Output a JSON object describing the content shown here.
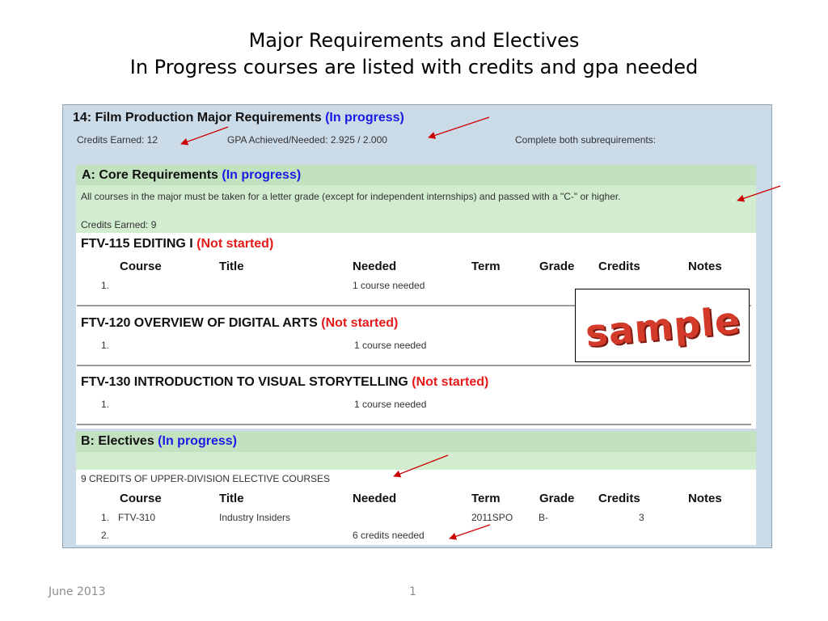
{
  "slide": {
    "title_line1": "Major Requirements and Electives",
    "title_line2": "In Progress courses are listed with credits and gpa needed",
    "footer_date": "June 2013",
    "page_number": "1"
  },
  "major": {
    "title": "14: Film Production Major Requirements",
    "status": "(In progress)",
    "credits_earned": "Credits Earned: 12",
    "gpa": "GPA Achieved/Needed: 2.925 / 2.000",
    "instruction": "Complete both subrequirements:"
  },
  "core": {
    "title": "A: Core Requirements",
    "status": "(In progress)",
    "note": "All courses in the major must be taken for a letter grade (except for independent internships) and passed with a \"C-\" or higher.",
    "credits_earned": "Credits Earned: 9",
    "courses": [
      {
        "name": "FTV-115 EDITING I",
        "status": "(Not started)",
        "row_num": "1.",
        "needed": "1 course needed"
      },
      {
        "name": "FTV-120 OVERVIEW OF DIGITAL ARTS",
        "status": "(Not started)",
        "row_num": "1.",
        "needed": "1 course needed"
      },
      {
        "name": "FTV-130 INTRODUCTION TO VISUAL STORYTELLING",
        "status": "(Not started)",
        "row_num": "1.",
        "needed": "1 course needed"
      }
    ]
  },
  "columns": [
    "Course",
    "Title",
    "Needed",
    "Term",
    "Grade",
    "Credits",
    "Notes"
  ],
  "electives": {
    "title": "B: Electives",
    "status": "(In progress)",
    "description": "9 CREDITS OF UPPER-DIVISION ELECTIVE COURSES",
    "rows": [
      {
        "num": "1.",
        "course": "FTV-310",
        "title": "Industry Insiders",
        "needed": "",
        "term": "2011SPO",
        "grade": "B-",
        "credits": "3",
        "notes": ""
      },
      {
        "num": "2.",
        "course": "",
        "title": "",
        "needed": "6 credits needed",
        "term": "",
        "grade": "",
        "credits": "",
        "notes": ""
      }
    ]
  },
  "stamp": {
    "text": "sample"
  },
  "colors": {
    "panel_bg": "#ccdbe8",
    "green_header": "#c2e1bf",
    "green_band": "#d2ecd0",
    "in_progress": "#1a1ae6",
    "not_started": "#e61a1a",
    "arrow": "#cc0000",
    "stamp_red": "#d43a2a"
  }
}
